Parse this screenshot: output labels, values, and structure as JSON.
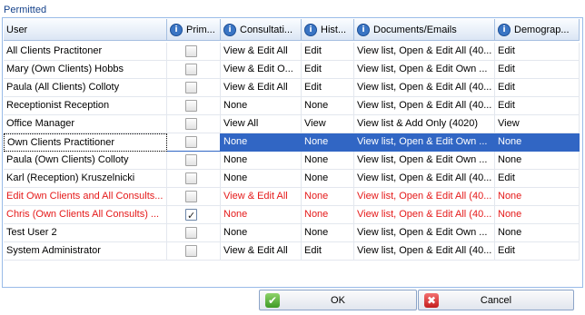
{
  "group_title": "Permitted",
  "columns": [
    {
      "label": "User",
      "info": false
    },
    {
      "label": "Prim...",
      "info": true
    },
    {
      "label": "Consultati...",
      "info": true
    },
    {
      "label": "Hist...",
      "info": true
    },
    {
      "label": "Documents/Emails",
      "info": true
    },
    {
      "label": "Demograp...",
      "info": true
    }
  ],
  "rows": [
    {
      "user": "All Clients Practitoner",
      "primary": false,
      "consultations": "View & Edit All",
      "history": "Edit",
      "documents": "View list, Open & Edit All (40...",
      "demographics": "Edit",
      "state": "normal"
    },
    {
      "user": "Mary (Own Clients) Hobbs",
      "primary": false,
      "consultations": "View & Edit O...",
      "history": "Edit",
      "documents": "View list, Open & Edit Own ...",
      "demographics": "Edit",
      "state": "normal"
    },
    {
      "user": "Paula (All Clients) Colloty",
      "primary": false,
      "consultations": "View & Edit All",
      "history": "Edit",
      "documents": "View list, Open & Edit All (40...",
      "demographics": "Edit",
      "state": "normal"
    },
    {
      "user": "Receptionist Reception",
      "primary": false,
      "consultations": "None",
      "history": "None",
      "documents": "View list, Open & Edit All (40...",
      "demographics": "Edit",
      "state": "normal"
    },
    {
      "user": "Office Manager",
      "primary": false,
      "consultations": "View All",
      "history": "View",
      "documents": "View list & Add Only (4020)",
      "demographics": "View",
      "state": "normal"
    },
    {
      "user": "Own Clients Practitioner",
      "primary": false,
      "consultations": "None",
      "history": "None",
      "documents": "View list, Open & Edit Own ...",
      "demographics": "None",
      "state": "selected"
    },
    {
      "user": "Paula (Own Clients) Colloty",
      "primary": false,
      "consultations": "None",
      "history": "None",
      "documents": "View list, Open & Edit Own ...",
      "demographics": "None",
      "state": "normal"
    },
    {
      "user": "Karl (Reception) Kruszelnicki",
      "primary": false,
      "consultations": "None",
      "history": "None",
      "documents": "View list, Open & Edit All (40...",
      "demographics": "Edit",
      "state": "normal"
    },
    {
      "user": "Edit Own Clients and All Consults...",
      "primary": false,
      "consultations": "View & Edit All",
      "history": "None",
      "documents": "View list, Open & Edit All (40...",
      "demographics": "None",
      "state": "red"
    },
    {
      "user": "Chris (Own Clients All Consults) ...",
      "primary": true,
      "consultations": "None",
      "history": "None",
      "documents": "View list, Open & Edit All (40...",
      "demographics": "None",
      "state": "red"
    },
    {
      "user": "Test User 2",
      "primary": false,
      "consultations": "None",
      "history": "None",
      "documents": "View list, Open & Edit Own ...",
      "demographics": "None",
      "state": "normal"
    },
    {
      "user": "System Administrator",
      "primary": false,
      "consultations": "View & Edit All",
      "history": "Edit",
      "documents": "View list, Open & Edit All (40...",
      "demographics": "Edit",
      "state": "normal"
    }
  ],
  "buttons": {
    "ok_label": "OK",
    "cancel_label": "Cancel"
  },
  "icons": {
    "column_info": "info-icon",
    "ok": "checkmark-icon",
    "cancel": "cancel-icon"
  },
  "colors": {
    "selection": "#3166c4",
    "warning_text": "#e51a1a",
    "header_text": "#15428b"
  }
}
